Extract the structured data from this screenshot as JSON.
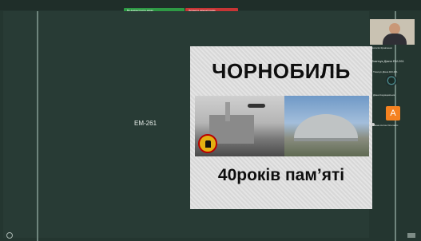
{
  "meeting": {
    "share_bar": {
      "green_label": "Ви демонструєте екран",
      "red_label": "Зупинити демонстрацію"
    },
    "group_label": "ЕМ-261",
    "poster": {
      "title": "ЧОРНОБИЛЬ",
      "subtitle": "40років пам’яті"
    },
    "participants_panel": {
      "cam_name": "Наталія Кравченко",
      "second_name": "Тканчук Діана ЕМ-261",
      "line3": "Тканчук Діана ЕМ-261",
      "line4": "Діана Кадищевська",
      "avatar_letter": "А",
      "line5": "Ганна Антон Олегович"
    }
  },
  "colors": {
    "background": "#243630",
    "share_green": "#2e9a45",
    "share_red": "#c73535",
    "avatar": "#f58220"
  }
}
